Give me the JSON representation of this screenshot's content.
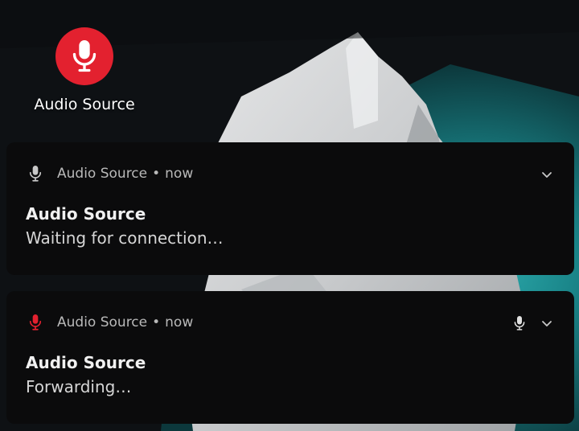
{
  "colors": {
    "brand_red": "#e3212f",
    "header_icon_grey": "#c8c8c8",
    "header_icon_red": "#e3212f",
    "wallpaper_teal": "#1a8a8e",
    "notification_bg": "#0b0b0c"
  },
  "desktop": {
    "shortcut": {
      "label": "Audio Source",
      "icon": "microphone-icon"
    }
  },
  "notifications": [
    {
      "app_name": "Audio Source",
      "separator": "•",
      "time": "now",
      "icon": "microphone-icon",
      "icon_color": "grey",
      "title": "Audio Source",
      "text": "Waiting for connection…",
      "has_mic_action": false,
      "expand_icon": "chevron-down-icon"
    },
    {
      "app_name": "Audio Source",
      "separator": "•",
      "time": "now",
      "icon": "microphone-icon",
      "icon_color": "red",
      "title": "Audio Source",
      "text": "Forwarding…",
      "has_mic_action": true,
      "mic_action_icon": "microphone-icon",
      "expand_icon": "chevron-down-icon"
    }
  ]
}
